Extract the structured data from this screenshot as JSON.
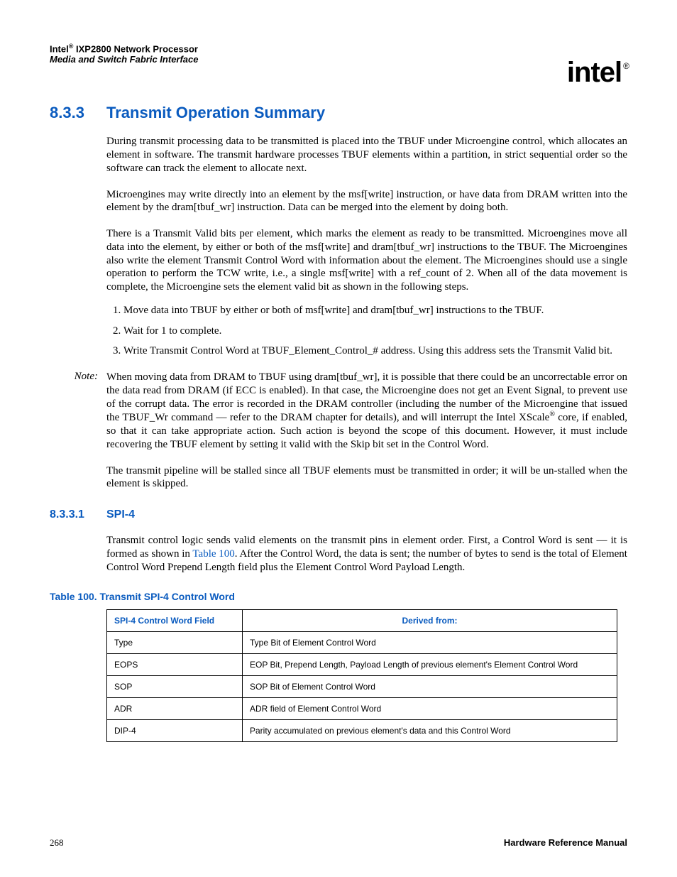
{
  "header": {
    "line1_prefix": "Intel",
    "line1_suffix": " IXP2800 Network Processor",
    "line2": "Media and Switch Fabric Interface"
  },
  "logo": {
    "text": "intel",
    "reg": "®"
  },
  "section": {
    "num": "8.3.3",
    "title": "Transmit Operation Summary",
    "p1": "During transmit processing data to be transmitted is placed into the TBUF under Microengine control, which allocates an element in software. The transmit hardware processes TBUF elements within a partition, in strict sequential order so the software can track the element to allocate next.",
    "p2": "Microengines may write directly into an element by the msf[write] instruction, or have data from DRAM written into the element by the dram[tbuf_wr] instruction. Data can be merged into the element by doing both.",
    "p3": "There is a Transmit Valid bits per element, which marks the element as ready to be transmitted. Microengines move all data into the element, by either or both of the msf[write] and dram[tbuf_wr] instructions to the TBUF. The Microengines also write the element Transmit Control Word with information about the element. The Microengines should use a single operation to perform the TCW write, i.e., a single msf[write] with a ref_count of 2. When all of the data movement is complete, the Microengine sets the element valid bit as shown in the following steps.",
    "li1": "Move data into TBUF by either or both of msf[write] and dram[tbuf_wr] instructions to the TBUF.",
    "li2": "Wait for 1 to complete.",
    "li3": "Write Transmit Control Word at TBUF_Element_Control_# address. Using this address sets the Transmit Valid bit.",
    "note_label": "Note:",
    "note_a": "When moving data from DRAM to TBUF using dram[tbuf_wr], it is possible that there could be an uncorrectable error on the data read from DRAM (if ECC is enabled). In that case, the Microengine does not get an Event Signal, to prevent use of the corrupt data. The error is recorded in the DRAM controller (including the number of the Microengine that issued the TBUF_Wr command — refer to the DRAM chapter for details), and will interrupt the Intel XScale",
    "note_b": " core, if enabled, so that it can take appropriate action. Such action is beyond the scope of this document. However, it must include recovering the TBUF element by setting it valid with the Skip bit set in the Control Word.",
    "p4": "The transmit pipeline will be stalled since all TBUF elements must be transmitted in order; it will be un-stalled when the element is skipped."
  },
  "subsection": {
    "num": "8.3.3.1",
    "title": "SPI-4",
    "p1a": "Transmit control logic sends valid elements on the transmit pins in element order. First, a Control Word is sent — it is formed as shown in ",
    "link": "Table 100",
    "p1b": ". After the Control Word, the data is sent; the number of bytes to send is the total of Element Control Word Prepend Length field plus the Element Control Word Payload Length."
  },
  "table": {
    "caption": "Table 100. Transmit SPI-4 Control Word",
    "h1": "SPI-4 Control Word Field",
    "h2": "Derived from:",
    "rows": [
      {
        "f": "Type",
        "d": "Type Bit of Element Control Word"
      },
      {
        "f": "EOPS",
        "d": "EOP Bit, Prepend Length, Payload Length of previous element's Element Control Word"
      },
      {
        "f": "SOP",
        "d": "SOP Bit of Element Control Word"
      },
      {
        "f": "ADR",
        "d": "ADR field of Element Control Word"
      },
      {
        "f": "DIP-4",
        "d": "Parity accumulated on previous element's data and this Control Word"
      }
    ]
  },
  "footer": {
    "page": "268",
    "manual": "Hardware Reference Manual"
  }
}
